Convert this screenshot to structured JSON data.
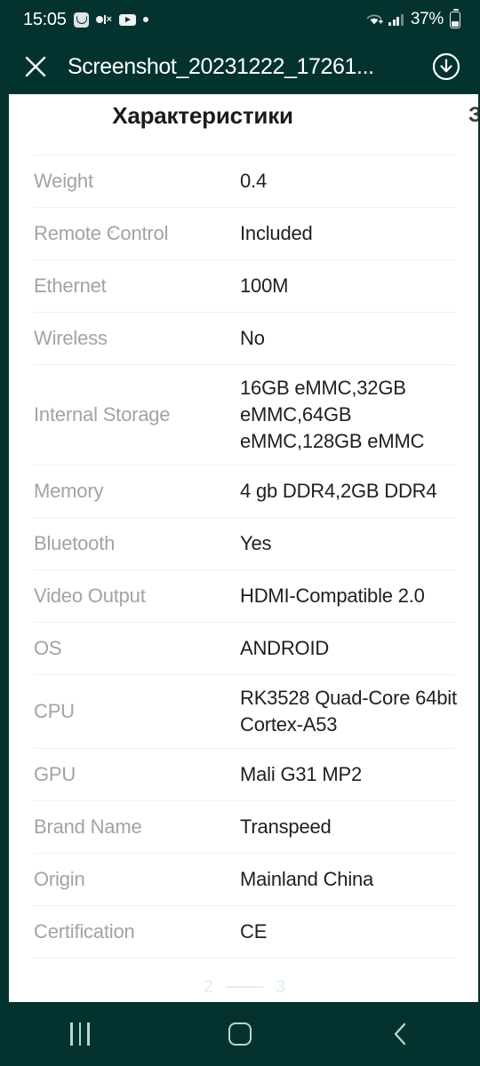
{
  "theme": {
    "bar_background": "#04332f",
    "bar_foreground": "#ffffff",
    "page_background": "#ffffff",
    "label_color": "#a3a3a3",
    "value_color": "#1f1f1f",
    "divider_color": "#f0f0f0",
    "pager_color": "#dff0ee",
    "nav_icon_color": "#b9d4d1"
  },
  "status_bar": {
    "time": "15:05",
    "battery_percent": "37%",
    "icons": [
      "messages-icon",
      "kakaotalk-mute-icon",
      "youtube-icon",
      "notification-dot-icon",
      "wifi-icon",
      "signal-icon",
      "battery-icon"
    ]
  },
  "app_bar": {
    "close_icon": "close-icon",
    "title": "Screenshot_20231222_17261...",
    "download_icon": "download-circle-icon"
  },
  "content": {
    "heading": "Характеристики",
    "edge_clipped_glyph": "З",
    "rows": [
      {
        "label": "Weight",
        "value": "0.4"
      },
      {
        "label": "Remote Control",
        "value": "Included"
      },
      {
        "label": "Ethernet",
        "value": "100M"
      },
      {
        "label": "Wireless",
        "value": "No"
      },
      {
        "label": "Internal Storage",
        "value": "16GB eMMC,32GB\neMMC,64GB\neMMC,128GB eMMC"
      },
      {
        "label": "Memory",
        "value": "4 gb DDR4,2GB DDR4"
      },
      {
        "label": "Bluetooth",
        "value": "Yes"
      },
      {
        "label": "Video Output",
        "value": "HDMI-Compatible 2.0"
      },
      {
        "label": "OS",
        "value": "ANDROID"
      },
      {
        "label": "CPU",
        "value": "RK3528 Quad-Core 64bit\nCortex-A53"
      },
      {
        "label": "GPU",
        "value": "Mali G31 MP2"
      },
      {
        "label": "Brand Name",
        "value": "Transpeed"
      },
      {
        "label": "Origin",
        "value": "Mainland China"
      },
      {
        "label": "Certification",
        "value": "CE"
      }
    ],
    "pager": {
      "prev_page": "2",
      "next_page": "3"
    }
  },
  "nav_bar": {
    "recents_label": "recents-icon",
    "home_label": "home-icon",
    "back_label": "back-icon"
  }
}
